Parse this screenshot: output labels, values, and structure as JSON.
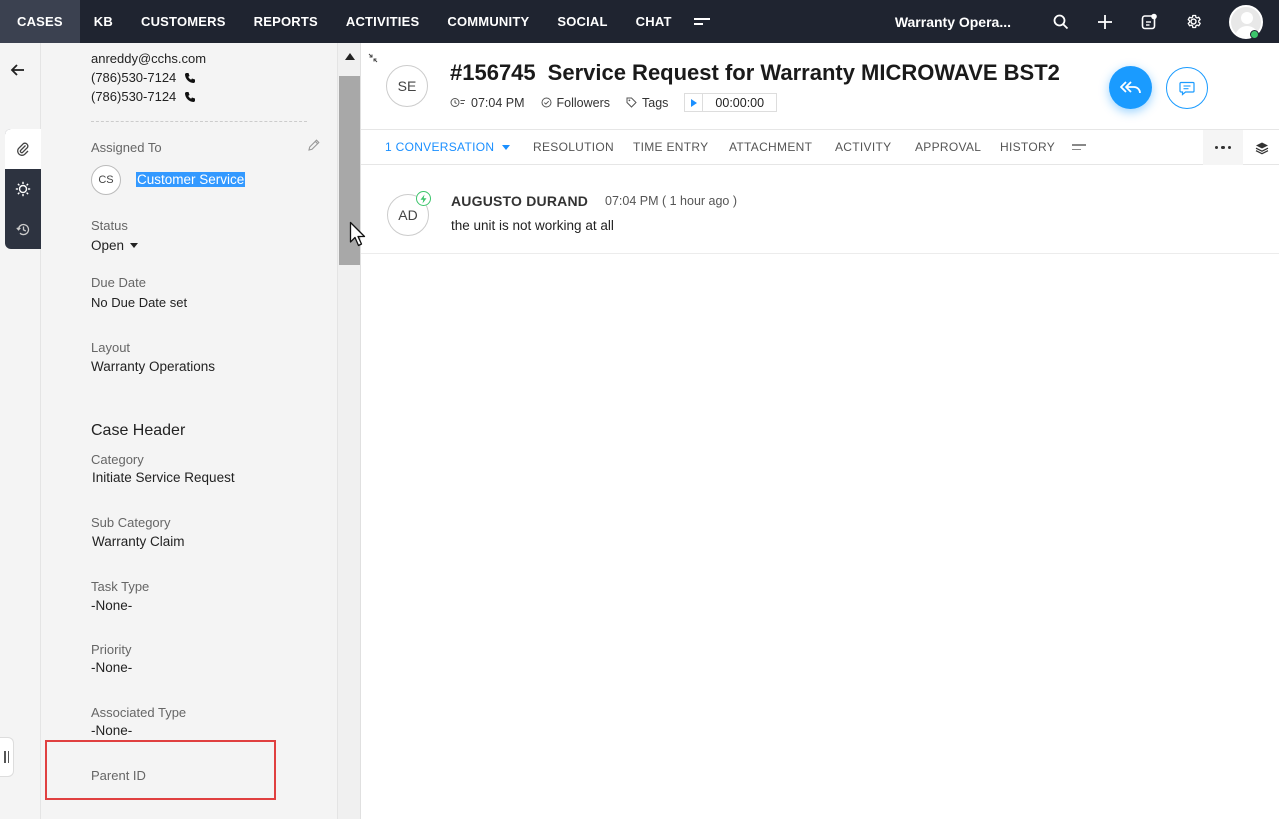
{
  "topnav": {
    "tabs": [
      "CASES",
      "KB",
      "CUSTOMERS",
      "REPORTS",
      "ACTIVITIES",
      "COMMUNITY",
      "SOCIAL",
      "CHAT"
    ],
    "active_tab": "CASES",
    "department": "Warranty Opera..."
  },
  "left_panel": {
    "email": "anreddy@cchs.com",
    "phones": [
      "(786)530-7124",
      "(786)530-7124"
    ],
    "assigned_to_label": "Assigned To",
    "assignee_initials": "CS",
    "assignee_name": "Customer Service",
    "status_label": "Status",
    "status_value": "Open",
    "due_date_label": "Due Date",
    "due_date_value": "No Due Date set",
    "layout_label": "Layout",
    "layout_value": "Warranty Operations",
    "section_title": "Case Header",
    "fields": [
      {
        "label": "Category",
        "value": "Initiate Service Request"
      },
      {
        "label": "Sub Category",
        "value": "Warranty Claim"
      },
      {
        "label": "Task Type",
        "value": "-None-"
      },
      {
        "label": "Priority",
        "value": "-None-"
      },
      {
        "label": "Associated Type",
        "value": "-None-"
      },
      {
        "label": "Parent ID",
        "value": "-"
      }
    ]
  },
  "case": {
    "requester_initials": "SE",
    "number": "#156745",
    "subject": "Service Request for Warranty MICROWAVE BST2",
    "time": "07:04 PM",
    "followers_label": "Followers",
    "tags_label": "Tags",
    "timer": "00:00:00"
  },
  "tabs": {
    "conversation": "1 CONVERSATION",
    "resolution": "RESOLUTION",
    "time_entry": "TIME ENTRY",
    "attachment": "ATTACHMENT",
    "activity": "ACTIVITY",
    "approval": "APPROVAL",
    "history": "HISTORY"
  },
  "thread": {
    "author_initials": "AD",
    "author": "AUGUSTO DURAND",
    "time": "07:04 PM ( 1 hour ago )",
    "message": "the unit is not working at all"
  },
  "colors": {
    "topnav_bg": "#1f2430",
    "accent": "#1a9bff",
    "selection": "#3399ff",
    "highlight_box": "#e04040"
  },
  "icons": [
    "search-icon",
    "plus-icon",
    "compose-icon",
    "gear-icon",
    "back-arrow-icon",
    "clip-icon",
    "bulb-icon",
    "history-icon",
    "pencil-icon",
    "phone-icon",
    "reply-all-icon",
    "comment-icon",
    "clock-icon",
    "check-circle-icon",
    "tag-icon",
    "play-icon",
    "more-icon",
    "layers-icon",
    "lightning-icon"
  ]
}
